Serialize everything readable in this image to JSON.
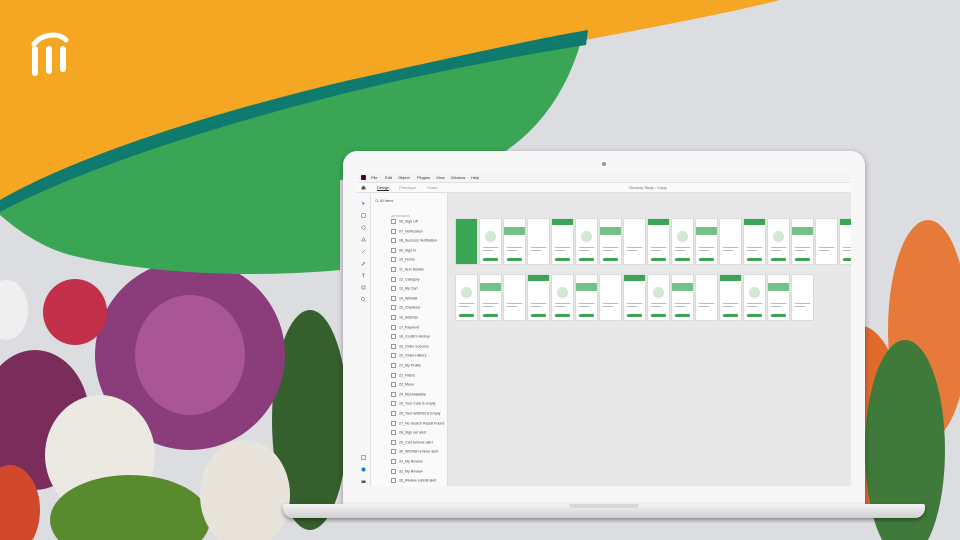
{
  "colors": {
    "orange": "#f5a623",
    "green": "#3aa655",
    "teal": "#0f7a6e",
    "brand": "#470137"
  },
  "menubar": {
    "items": [
      "File",
      "Edit",
      "Object",
      "Plugins",
      "View",
      "Window",
      "Help"
    ]
  },
  "tabs": [
    "Design",
    "Prototype",
    "Share"
  ],
  "document_title": "Grocery Shop - Copy",
  "layers": {
    "search_placeholder": "All Items",
    "section_label": "ARTBOARDS",
    "items": [
      "06_Sign UP",
      "07_Verification",
      "08_Success Verification",
      "09_Sign In",
      "10_Home",
      "11_Item Details",
      "12_Category",
      "13_My Cart",
      "14_Wishlist",
      "15_Checkout",
      "16_Address",
      "17_Payment",
      "18_Confirm History",
      "19_Order Success",
      "20_Order History",
      "21_My Profile",
      "22_Filters",
      "23_Menu",
      "24_Not Available",
      "25_Your Card is empty",
      "26_Your Wishlist is Empty",
      "27_No Search Result Found",
      "28_Sign out alert",
      "29_Cart remove alert",
      "30_Wishlist remove alert",
      "31_My Review",
      "32_My Review",
      "33_Review submit alert"
    ]
  },
  "icons": [
    "logo-icon",
    "select-tool-icon",
    "rectangle-tool-icon",
    "ellipse-tool-icon",
    "polygon-tool-icon",
    "line-tool-icon",
    "pen-tool-icon",
    "text-tool-icon",
    "artboard-tool-icon",
    "zoom-tool-icon",
    "home-icon",
    "assets-icon",
    "plugins-icon"
  ]
}
